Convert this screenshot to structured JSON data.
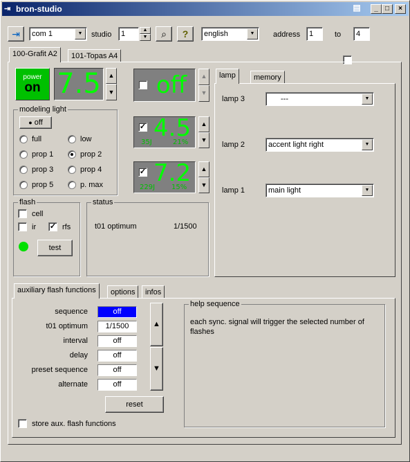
{
  "app": {
    "title": "bron-studio",
    "titlebar_buttons": [
      "minimize-icon",
      "maximize-icon",
      "close-icon"
    ]
  },
  "toolbar": {
    "port_value": "com 1",
    "studio_label": "studio",
    "studio_value": "1",
    "language_value": "english",
    "address_label": "address",
    "address_from": "1",
    "to_label": "to",
    "address_to": "4"
  },
  "device_tabs": [
    "100-Grafit A2",
    "101-Topas A4"
  ],
  "power": {
    "label_top": "power",
    "label_state": "on",
    "value": "7.5"
  },
  "generator_off": {
    "value": "off"
  },
  "channel_a": {
    "value": "4.5",
    "energy": "35J",
    "ratio": "21%"
  },
  "channel_b": {
    "value": "7.2",
    "energy": "229J",
    "ratio": "15%"
  },
  "modeling": {
    "title": "modeling light",
    "off_button": "off",
    "options": [
      "full",
      "low",
      "prop 1",
      "prop 2",
      "prop 3",
      "prop 4",
      "prop 5",
      "p. max"
    ],
    "selected": "prop 2"
  },
  "flash": {
    "title": "flash",
    "cell_label": "cell",
    "ir_label": "ir",
    "rfs_label": "rfs",
    "test_button": "test",
    "ready_color": "#00e000"
  },
  "status": {
    "title": "status",
    "label": "t01 optimum",
    "value": "1/1500"
  },
  "lamp_tabs": [
    "lamp",
    "memory"
  ],
  "lamps": [
    {
      "label": "lamp 3",
      "value": "---"
    },
    {
      "label": "lamp 2",
      "value": "accent light right"
    },
    {
      "label": "lamp 1",
      "value": "main light"
    }
  ],
  "bottom_tabs": [
    "auxiliary flash functions",
    "options",
    "infos"
  ],
  "aux": {
    "rows": [
      {
        "label": "sequence",
        "value": "off"
      },
      {
        "label": "t01 optimum",
        "value": "1/1500"
      },
      {
        "label": "interval",
        "value": "off"
      },
      {
        "label": "delay",
        "value": "off"
      },
      {
        "label": "preset sequence",
        "value": "off"
      },
      {
        "label": "alternate",
        "value": "off"
      }
    ],
    "reset_button": "reset",
    "store_label": "store aux. flash functions"
  },
  "help": {
    "title": "help sequence",
    "text": "each sync. signal will trigger the selected number of flashes"
  },
  "colors": {
    "display_bg": "#808080",
    "display_fg": "#00ff00",
    "power_bg": "#00c000",
    "selected_field": "#0000ff"
  }
}
